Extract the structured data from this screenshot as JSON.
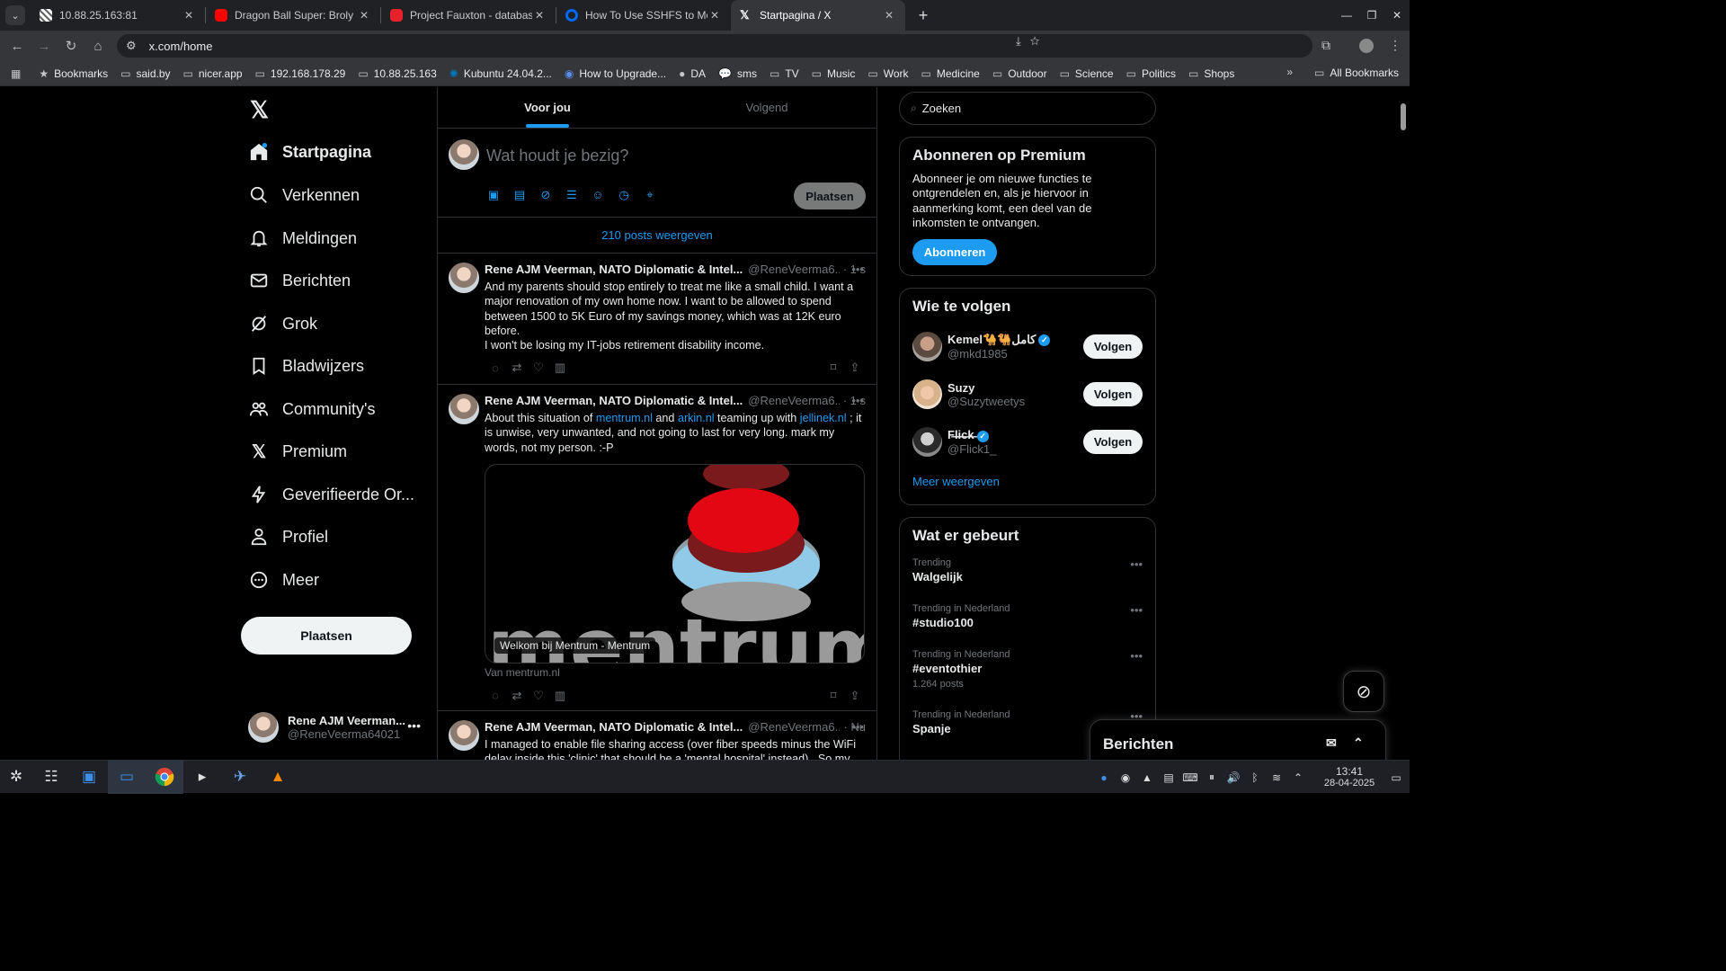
{
  "browser": {
    "tabs": [
      {
        "title": "10.88.25.163:81",
        "color": "#ffffff",
        "active": false
      },
      {
        "title": "Dragon Ball Super: Broly - A",
        "color": "#ff0000",
        "active": false
      },
      {
        "title": "Project Fauxton - database",
        "color": "#e8222d",
        "active": false
      },
      {
        "title": "How To Use SSHFS to Moun",
        "color": "#0069ff",
        "active": false
      },
      {
        "title": "Startpagina / X",
        "color": "#ffffff",
        "active": true
      }
    ],
    "url": "x.com/home",
    "bookmarks": [
      "Bookmarks",
      "said.by",
      "nicer.app",
      "192.168.178.29",
      "10.88.25.163",
      "Kubuntu 24.04.2...",
      "How to Upgrade...",
      "DA",
      "sms",
      "TV",
      "Music",
      "Work",
      "Medicine",
      "Outdoor",
      "Science",
      "Politics",
      "Shops"
    ],
    "all_bookmarks": "All Bookmarks"
  },
  "nav": {
    "items": [
      {
        "label": "Startpagina",
        "icon": "home-icon"
      },
      {
        "label": "Verkennen",
        "icon": "search-icon"
      },
      {
        "label": "Meldingen",
        "icon": "bell-icon"
      },
      {
        "label": "Berichten",
        "icon": "mail-icon"
      },
      {
        "label": "Grok",
        "icon": "grok-icon"
      },
      {
        "label": "Bladwijzers",
        "icon": "bookmark-icon"
      },
      {
        "label": "Community's",
        "icon": "community-icon"
      },
      {
        "label": "Premium",
        "icon": "x-icon"
      },
      {
        "label": "Geverifieerde Or...",
        "icon": "lightning-icon"
      },
      {
        "label": "Profiel",
        "icon": "person-icon"
      },
      {
        "label": "Meer",
        "icon": "more-icon"
      }
    ],
    "post_label": "Plaatsen",
    "account": {
      "name": "Rene AJM Veerman...",
      "handle": "@ReneVeerma64021"
    }
  },
  "timeline": {
    "tabs": [
      "Voor jou",
      "Volgend"
    ],
    "compose_placeholder": "Wat houdt je bezig?",
    "compose_post": "Plaatsen",
    "show_posts": "210 posts weergeven",
    "tweets": [
      {
        "name": "Rene AJM Veerman, NATO Diplomatic & Intel...",
        "handle": "@ReneVeerma6...",
        "time": "· 1 s",
        "text_lines": [
          "And my parents should stop entirely to treat me like a small child. I want a major renovation of my own home now. I want to be allowed to spend between 1500 to 5K Euro of my savings money, which was at 12K euro before.",
          "I won't be losing my IT-jobs retirement disability income."
        ]
      },
      {
        "name": "Rene AJM Veerman, NATO Diplomatic & Intel...",
        "handle": "@ReneVeerma6...",
        "time": "· 1 s",
        "text_a": "About this situation of ",
        "link1": "mentrum.nl",
        "text_b": " and ",
        "link2": "arkin.nl",
        "text_c": " teaming up with ",
        "link3": "jellinek.nl",
        "text_d": " ; it is unwise, very unwanted, and not going to last for very long. mark my words, not my person. :-P",
        "card_caption": "Welkom bij Mentrum - Mentrum",
        "card_logo_text": "mentrum",
        "card_from": "Van mentrum.nl"
      },
      {
        "name": "Rene AJM Veerman, NATO Diplomatic & Intel...",
        "handle": "@ReneVeerma6...",
        "time": "· Nu",
        "text": "I managed to enable file sharing access (over fiber speeds minus the WiFi delay inside this 'clinic' that should be a 'mental hospital' instead).. So my"
      }
    ]
  },
  "sidebar": {
    "search_placeholder": "Zoeken",
    "premium": {
      "title": "Abonneren op Premium",
      "text": "Abonneer je om nieuwe functies te ontgrendelen en, als je hiervoor in aanmerking komt, een deel van de inkomsten te ontvangen.",
      "button": "Abonneren"
    },
    "who_to_follow": {
      "title": "Wie te volgen",
      "users": [
        {
          "name": "Kemel🐪🐫كامل",
          "handle": "@mkd1985",
          "verified": true
        },
        {
          "name": "Suzy",
          "handle": "@Suzytweetys",
          "verified": false
        },
        {
          "name": "F̶l̶i̶c̶k̶",
          "handle": "@Flick1_",
          "verified": true
        }
      ],
      "follow_label": "Volgen",
      "more": "Meer weergeven"
    },
    "happening": {
      "title": "Wat er gebeurt",
      "trends": [
        {
          "context": "Trending",
          "topic": "Walgelijk",
          "count": ""
        },
        {
          "context": "Trending in Nederland",
          "topic": "#studio100",
          "count": ""
        },
        {
          "context": "Trending in Nederland",
          "topic": "#eventothier",
          "count": "1.264 posts"
        },
        {
          "context": "Trending in Nederland",
          "topic": "Spanje",
          "count": ""
        }
      ]
    }
  },
  "messages_drawer": {
    "title": "Berichten"
  },
  "taskbar": {
    "time": "13:41",
    "date": "28-04-2025"
  }
}
